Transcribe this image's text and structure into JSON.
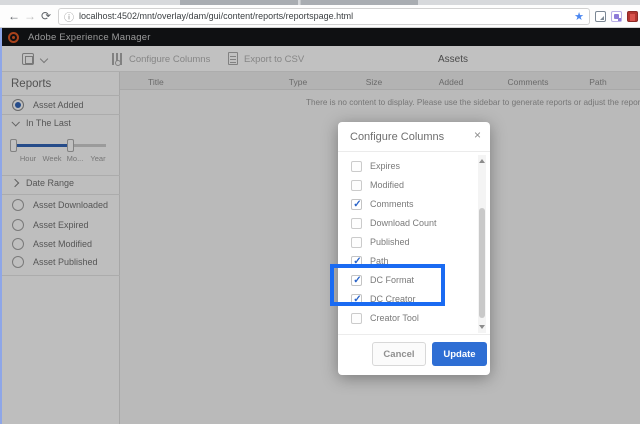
{
  "browser": {
    "url": "localhost:4502/mnt/overlay/dam/gui/content/reports/reportspage.html",
    "icons": {
      "back": "←",
      "forward": "→",
      "refresh": "⟳",
      "info": "ⓘ",
      "star": "★"
    }
  },
  "app": {
    "title": "Adobe Experience Manager",
    "toolbar": {
      "configure_columns_label": "Configure Columns",
      "export_csv_label": "Export to CSV",
      "page_title": "Assets"
    },
    "sidebar": {
      "title": "Reports",
      "report_types": [
        {
          "label": "Asset Added",
          "selected": true
        },
        {
          "label": "Asset Downloaded",
          "selected": false
        },
        {
          "label": "Asset Expired",
          "selected": false
        },
        {
          "label": "Asset Modified",
          "selected": false
        },
        {
          "label": "Asset Published",
          "selected": false
        }
      ],
      "in_the_last": {
        "label": "In The Last",
        "ticks": [
          "Hour",
          "Week",
          "Mo...",
          "Year"
        ]
      },
      "date_range_label": "Date Range"
    },
    "table": {
      "columns": [
        "Title",
        "Type",
        "Size",
        "Added",
        "Comments",
        "Path"
      ],
      "empty_message": "There is no content to display. Please use the sidebar to generate reports or adjust the report generation query parameters."
    }
  },
  "dialog": {
    "title": "Configure Columns",
    "close_icon": "×",
    "items": [
      {
        "label": "Expires",
        "checked": false
      },
      {
        "label": "Modified",
        "checked": false
      },
      {
        "label": "Comments",
        "checked": true
      },
      {
        "label": "Download Count",
        "checked": false
      },
      {
        "label": "Published",
        "checked": false
      },
      {
        "label": "Path",
        "checked": true
      },
      {
        "label": "DC Format",
        "checked": true
      },
      {
        "label": "DC Creator",
        "checked": true
      },
      {
        "label": "Creator Tool",
        "checked": false
      }
    ],
    "cancel_label": "Cancel",
    "update_label": "Update"
  },
  "colors": {
    "accent_blue": "#2e6ed4",
    "annotation_blue": "#1a6bf2",
    "check_blue": "#2a64c8",
    "slider_blue": "#2f62b5",
    "logo_orange": "#dd5420",
    "star_blue": "#4a86f0"
  }
}
